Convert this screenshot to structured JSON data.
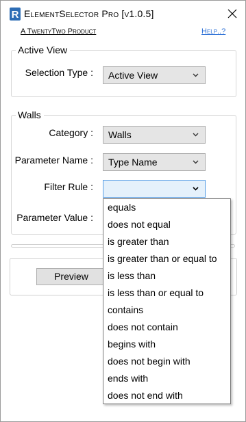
{
  "window": {
    "title": "ElementSelector Pro [v1.0.5]",
    "company_link": "A TwentyTwo Product",
    "help_link": "Help..?",
    "icons": {
      "app": "revit-r-icon",
      "close": "close-icon"
    }
  },
  "active_view": {
    "legend": "Active View",
    "selection_type_label": "Selection Type :",
    "selection_type_value": "Active View"
  },
  "walls": {
    "legend": "Walls",
    "category_label": "Category :",
    "category_value": "Walls",
    "parameter_name_label": "Parameter Name :",
    "parameter_name_value": "Type Name",
    "filter_rule_label": "Filter Rule :",
    "filter_rule_value": "",
    "parameter_value_label": "Parameter Value :"
  },
  "buttons": {
    "preview": "Preview"
  },
  "filter_rule_options": [
    "equals",
    "does not equal",
    "is greater than",
    "is greater than or equal to",
    "is less than",
    "is less than or equal to",
    "contains",
    "does not contain",
    "begins with",
    "does not begin with",
    "ends with",
    "does not end with"
  ],
  "colors": {
    "accent": "#2a6fd6",
    "focus_border": "#569de5",
    "app_icon": "#2d6db5"
  }
}
